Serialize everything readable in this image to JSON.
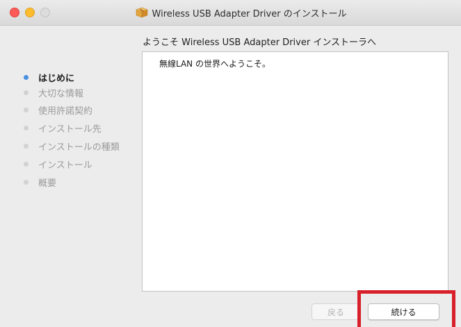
{
  "window": {
    "title": "Wireless USB Adapter Driver のインストール",
    "icon": "package-icon"
  },
  "sidebar": {
    "steps": [
      {
        "label": "はじめに",
        "active": true
      },
      {
        "label": "大切な情報",
        "active": false
      },
      {
        "label": "使用許諾契約",
        "active": false
      },
      {
        "label": "インストール先",
        "active": false
      },
      {
        "label": "インストールの種類",
        "active": false
      },
      {
        "label": "インストール",
        "active": false
      },
      {
        "label": "概要",
        "active": false
      }
    ]
  },
  "main": {
    "heading": "ようこそ Wireless USB Adapter Driver インストーラへ",
    "body_text": "無線LAN の世界へようこそ。"
  },
  "buttons": {
    "back_label": "戻る",
    "back_enabled": false,
    "continue_label": "続ける"
  },
  "colors": {
    "active_step_dot": "#4a90e2",
    "highlight_border": "#d8202a",
    "close_button": "#fc5b57",
    "minimize_button": "#fdbc2e"
  }
}
